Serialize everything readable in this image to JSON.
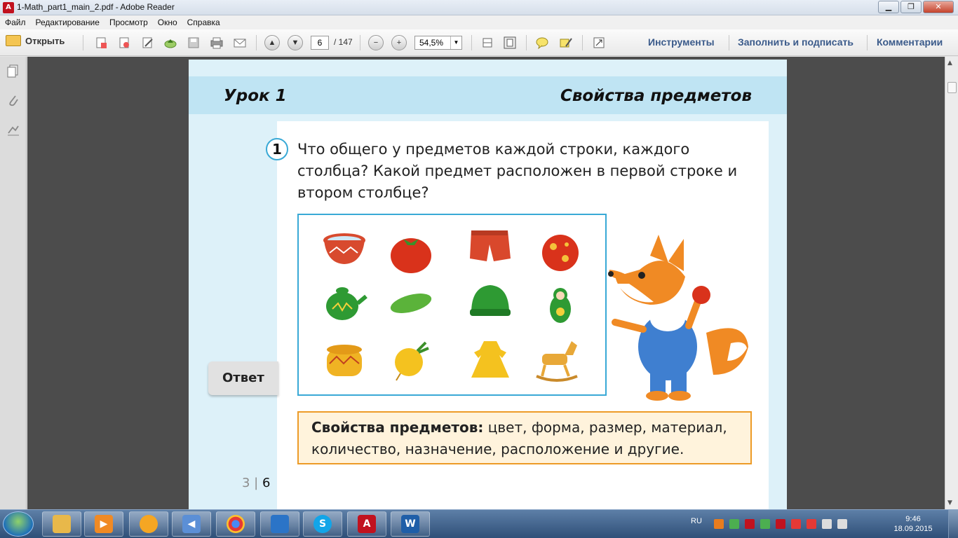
{
  "window": {
    "title": "1-Math_part1_main_2.pdf - Adobe Reader",
    "minimize": "▁",
    "maximize": "❐",
    "close": "✕"
  },
  "menu": [
    "Файл",
    "Редактирование",
    "Просмотр",
    "Окно",
    "Справка"
  ],
  "toolbar": {
    "open_label": "Открыть",
    "page_current": "6",
    "page_total": "/ 147",
    "zoom": "54,5%",
    "tools_label": "Инструменты",
    "fill_sign_label": "Заполнить и подписать",
    "comments_label": "Комментарии"
  },
  "page": {
    "lesson": "Урок 1",
    "topic": "Свойства предметов",
    "task_number": "1",
    "question": "Что общего у предметов каждой строки, каждого столбца? Какой предмет расположен в первой строке и втором столбце?",
    "answer_button": "Ответ",
    "properties_bold": "Свойства предметов:",
    "properties_text": " цвет, форма, размер, материал, количество, назначение, расположение и другие.",
    "page_left": "3",
    "page_sep": " | ",
    "page_right": "6"
  },
  "grid_items": [
    [
      "red-bowl",
      "tomato",
      "red-shorts",
      "red-ball"
    ],
    [
      "green-teapot",
      "cucumber",
      "green-hat",
      "green-matryoshka"
    ],
    [
      "yellow-pot",
      "turnip",
      "yellow-dress",
      "rocking-horse"
    ]
  ],
  "colors": {
    "accent_blue": "#39a9d6",
    "orange_border": "#ed9b27",
    "lesson_bar": "#bfe4f3"
  },
  "taskbar": {
    "lang": "RU",
    "time": "9:46",
    "date": "18.09.2015"
  }
}
